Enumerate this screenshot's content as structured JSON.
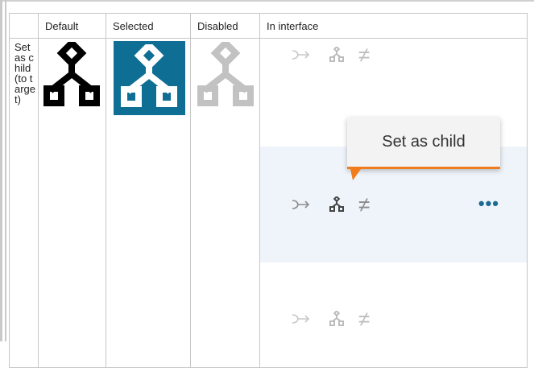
{
  "table": {
    "headers": [
      "",
      "Default",
      "Selected",
      "Disabled",
      "In interface"
    ],
    "row_name": "Set as child (to target)"
  },
  "tooltip": {
    "text": "Set as child"
  },
  "icons": {
    "main": "set-as-child-icon",
    "row_icons": [
      "follow-arrow-icon",
      "set-as-child-icon",
      "not-equal-icon"
    ],
    "more": "more-options-icon",
    "not_equal_glyph": "≠",
    "more_glyph": "•••"
  },
  "colors": {
    "selected_bg": "#0f6e93",
    "hover_row_bg": "#eef4f9",
    "tooltip_accent": "#f07c1e",
    "disabled_icon": "#c2c2c2"
  }
}
